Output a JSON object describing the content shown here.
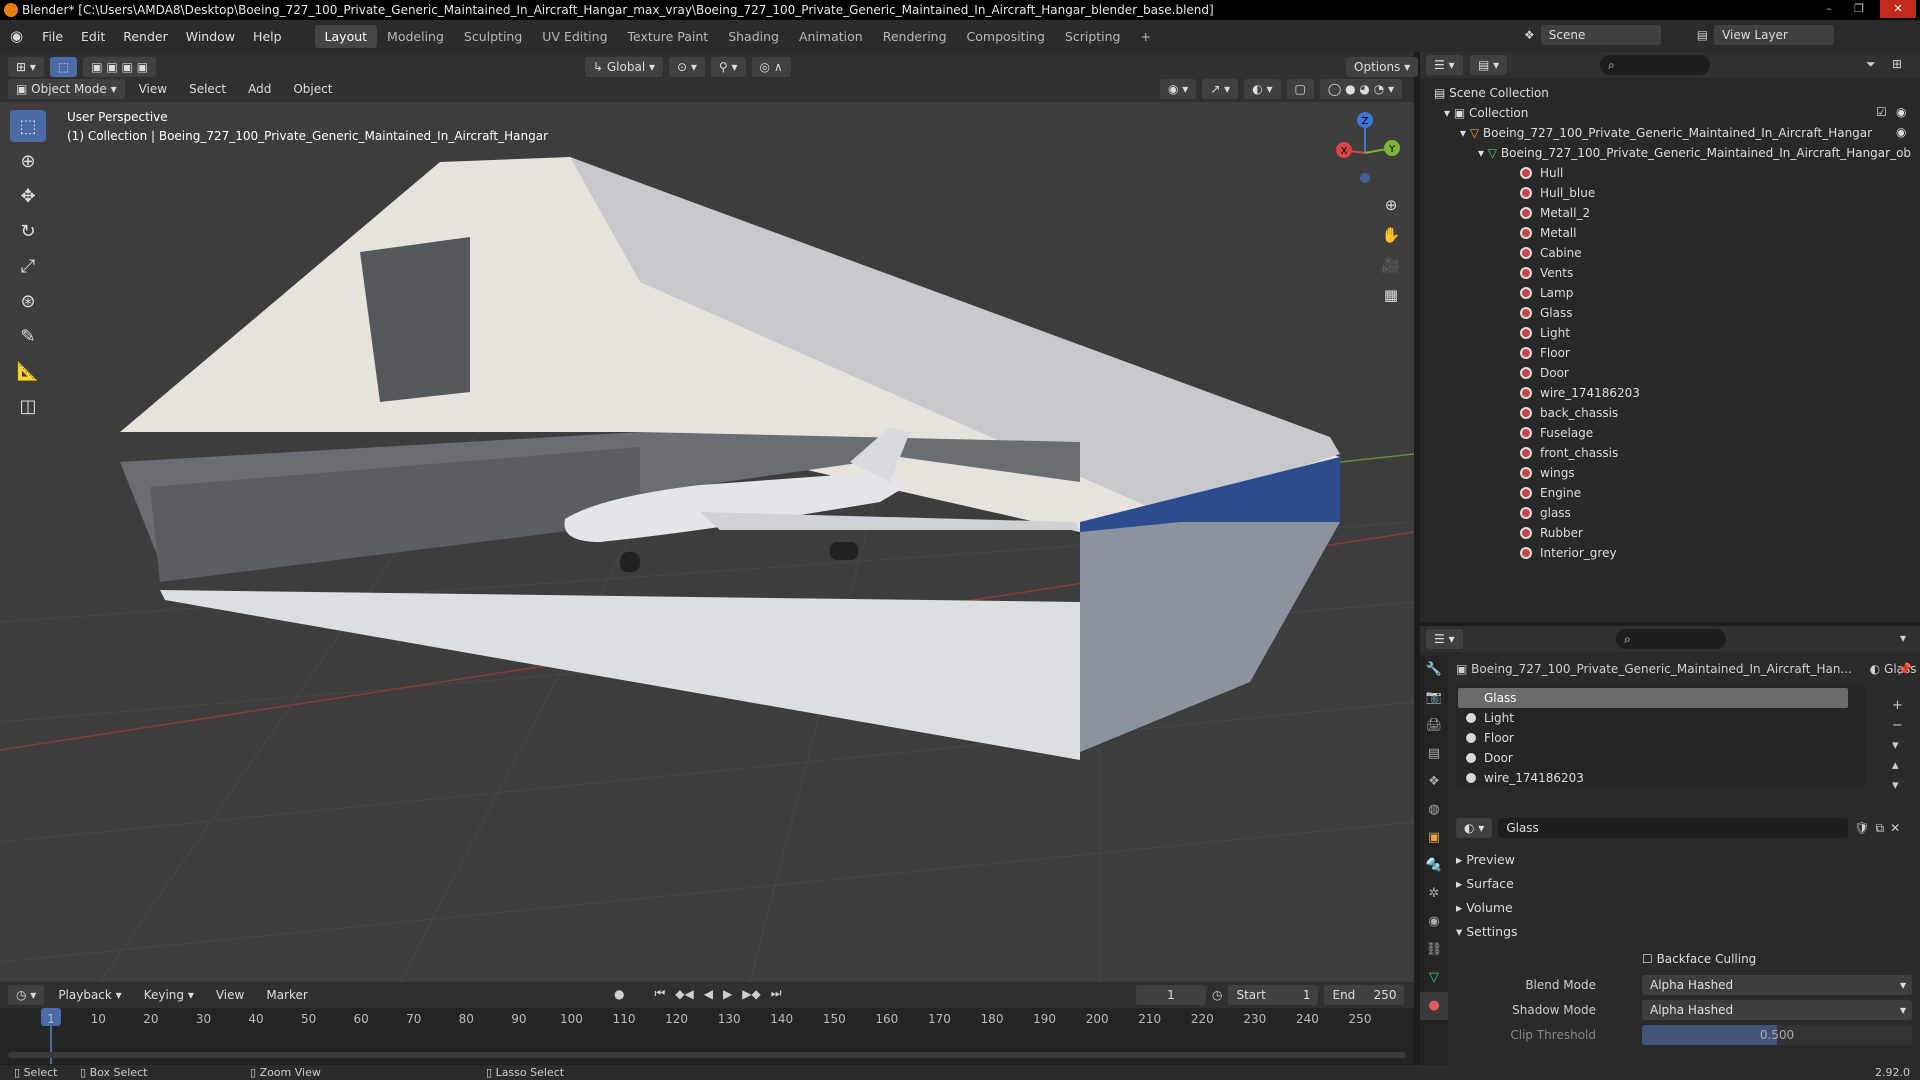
{
  "window": {
    "title": "Blender* [C:\\Users\\AMDA8\\Desktop\\Boeing_727_100_Private_Generic_Maintained_In_Aircraft_Hangar_max_vray\\Boeing_727_100_Private_Generic_Maintained_In_Aircraft_Hangar_blender_base.blend]"
  },
  "menu": {
    "items": [
      "File",
      "Edit",
      "Render",
      "Window",
      "Help"
    ]
  },
  "workspaces": [
    "Layout",
    "Modeling",
    "Sculpting",
    "UV Editing",
    "Texture Paint",
    "Shading",
    "Animation",
    "Rendering",
    "Compositing",
    "Scripting"
  ],
  "scene": {
    "name": "Scene",
    "view_layer": "View Layer"
  },
  "viewport": {
    "mode": "Object Mode",
    "menus": [
      "View",
      "Select",
      "Add",
      "Object"
    ],
    "transform": "Global",
    "options": "Options",
    "overlay_line1": "User Perspective",
    "overlay_line2": "(1) Collection | Boeing_727_100_Private_Generic_Maintained_In_Aircraft_Hangar",
    "gizmo": {
      "x": "X",
      "y": "Y",
      "z": "Z"
    }
  },
  "outliner": {
    "scene_collection": "Scene Collection",
    "collection": "Collection",
    "object": "Boeing_727_100_Private_Generic_Maintained_In_Aircraft_Hangar",
    "mesh": "Boeing_727_100_Private_Generic_Maintained_In_Aircraft_Hangar_ob",
    "materials": [
      "Hull",
      "Hull_blue",
      "Metall_2",
      "Metall",
      "Cabine",
      "Vents",
      "Lamp",
      "Glass",
      "Light",
      "Floor",
      "Door",
      "wire_174186203",
      "back_chassis",
      "Fuselage",
      "front_chassis",
      "wings",
      "Engine",
      "glass",
      "Rubber",
      "Interior_grey"
    ]
  },
  "properties": {
    "object_path": "Boeing_727_100_Private_Generic_Maintained_In_Aircraft_Han...",
    "material_name": "Glass",
    "slots": [
      "Glass",
      "Light",
      "Floor",
      "Door",
      "wire_174186203"
    ],
    "selected_slot": "Glass",
    "material_field": "Glass",
    "sections": [
      "Preview",
      "Surface",
      "Volume",
      "Settings"
    ],
    "backface": "Backface Culling",
    "blend_label": "Blend Mode",
    "blend_value": "Alpha Hashed",
    "shadow_label": "Shadow Mode",
    "shadow_value": "Alpha Hashed",
    "clip_label": "Clip Threshold",
    "clip_value": "0.500"
  },
  "timeline": {
    "menus": [
      "Playback",
      "Keying",
      "View",
      "Marker"
    ],
    "current_frame": "1",
    "start_label": "Start",
    "start": "1",
    "end_label": "End",
    "end": "250",
    "ticks": [
      "1",
      "10",
      "20",
      "30",
      "40",
      "50",
      "60",
      "70",
      "80",
      "90",
      "100",
      "110",
      "120",
      "130",
      "140",
      "150",
      "160",
      "170",
      "180",
      "190",
      "200",
      "210",
      "220",
      "230",
      "240",
      "250"
    ]
  },
  "status": {
    "select": "Select",
    "box_select": "Box Select",
    "zoom_view": "Zoom View",
    "lasso_select": "Lasso Select",
    "version": "2.92.0"
  },
  "colors": {
    "accent": "#4b6aa8",
    "header": "#303030",
    "panel": "#282828",
    "material": "#c94444"
  }
}
